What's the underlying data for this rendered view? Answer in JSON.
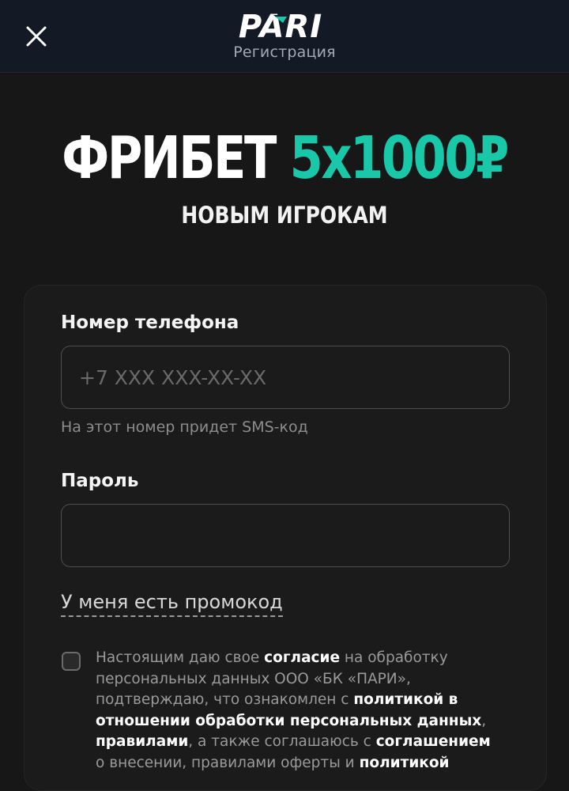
{
  "header": {
    "brand": "PARI",
    "subtitle": "Регистрация"
  },
  "promo": {
    "headline_white": "ФРИБЕТ",
    "headline_green": "5х1000₽",
    "subline": "НОВЫМ ИГРОКАМ",
    "accent_color": "#19c8a9"
  },
  "form": {
    "phone": {
      "label": "Номер телефона",
      "placeholder": "+7 XXX XXX-XX-XX",
      "value": "",
      "hint": "На этот номер придет SMS-код"
    },
    "password": {
      "label": "Пароль",
      "value": ""
    },
    "promocode_link": "У меня есть промокод",
    "consent": {
      "checked": false,
      "t1": "Настоящим даю свое ",
      "l1": "согласие",
      "t2": " на обработку персональных данных ООО «БК «ПАРИ», подтверждаю, что ознакомлен с ",
      "l2": "политикой в отношении обработки персональных данных",
      "t3": ", ",
      "l3": "правилами",
      "t4": ", а также соглашаюсь с ",
      "l4": "соглашением",
      "t5": " о внесении, правилами оферты и ",
      "l5": "политикой"
    }
  },
  "icons": {
    "close": "close-icon",
    "logo": "pari-logo"
  }
}
